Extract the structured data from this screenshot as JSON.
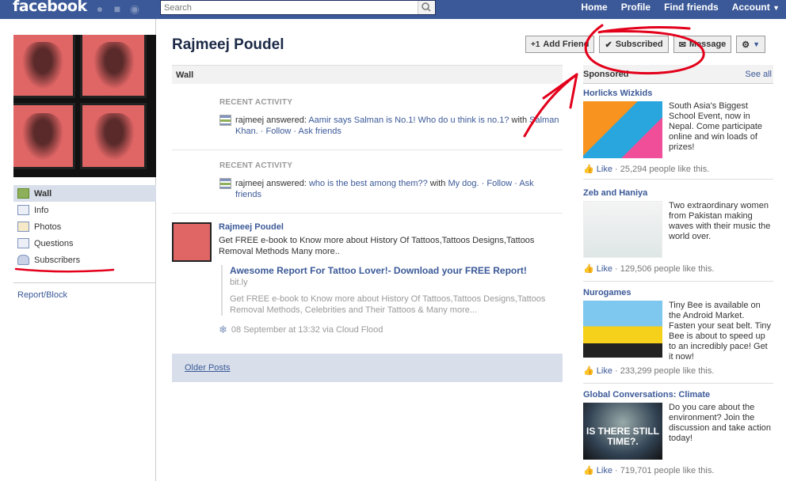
{
  "topbar": {
    "logo": "facebook",
    "search_placeholder": "Search",
    "nav": [
      "Home",
      "Profile",
      "Find friends",
      "Account"
    ]
  },
  "profile": {
    "name": "Rajmeej Poudel",
    "buttons": {
      "add_friend": "Add Friend",
      "subscribed": "Subscribed",
      "message": "Message"
    }
  },
  "leftnav": {
    "items": [
      "Wall",
      "Info",
      "Photos",
      "Questions",
      "Subscribers"
    ],
    "report": "Report/Block"
  },
  "wall": {
    "tab": "Wall",
    "activity1": {
      "title": "RECENT ACTIVITY",
      "prefix": "rajmeej answered: ",
      "link": "Aamir says Salman is No.1! Who do u think is no.1?",
      "with": " with ",
      "with_name": "Salman Khan.",
      "actions": " · Follow · Ask friends"
    },
    "activity2": {
      "title": "RECENT ACTIVITY",
      "prefix": "rajmeej answered: ",
      "link": "who is the best among them??",
      "with": " with ",
      "with_name": "My dog.",
      "follow": " · Follow · ",
      "ask": "Ask friends"
    },
    "post": {
      "author": "Rajmeej Poudel",
      "text": "Get FREE e-book to Know more about History Of Tattoos,Tattoos Designs,Tattoos Removal Methods Many more..",
      "attach_title": "Awesome Report For Tattoo Lover!- Download your FREE Report!",
      "attach_domain": "bit.ly",
      "attach_desc": "Get FREE e-book to Know more about History Of Tattoos,Tattoos Designs,Tattoos Removal Methods, Celebrities and Their Tattoos & Many more...",
      "meta": "08 September at 13:32 via Cloud Flood"
    },
    "older_posts": "Older Posts"
  },
  "sponsored": {
    "title": "Sponsored",
    "see_all": "See all",
    "like": "Like",
    "ads": [
      {
        "title": "Horlicks Wizkids",
        "text": "South Asia's Biggest School Event, now in Nepal. Come participate online and win loads of prizes!",
        "likes": " · 25,294 people like this."
      },
      {
        "title": "Zeb and Haniya",
        "text": "Two extraordinary women from Pakistan making waves with their music the world over.",
        "likes": " · 129,506 people like this."
      },
      {
        "title": "Nurogames",
        "text": "Tiny Bee is available on the Android Market. Fasten your seat belt. Tiny Bee is about to speed up to an incredibly pace! Get it now!",
        "likes": " · 233,299 people like this."
      },
      {
        "title": "Global Conversations: Climate",
        "text": "Do you care about the environment? Join the discussion and take action today!",
        "likes": " · 719,701 people like this.",
        "img_text": "IS THERE STILL TIME?."
      }
    ]
  },
  "colors": {
    "brand": "#3b5998",
    "annotation": "#e3001b"
  }
}
